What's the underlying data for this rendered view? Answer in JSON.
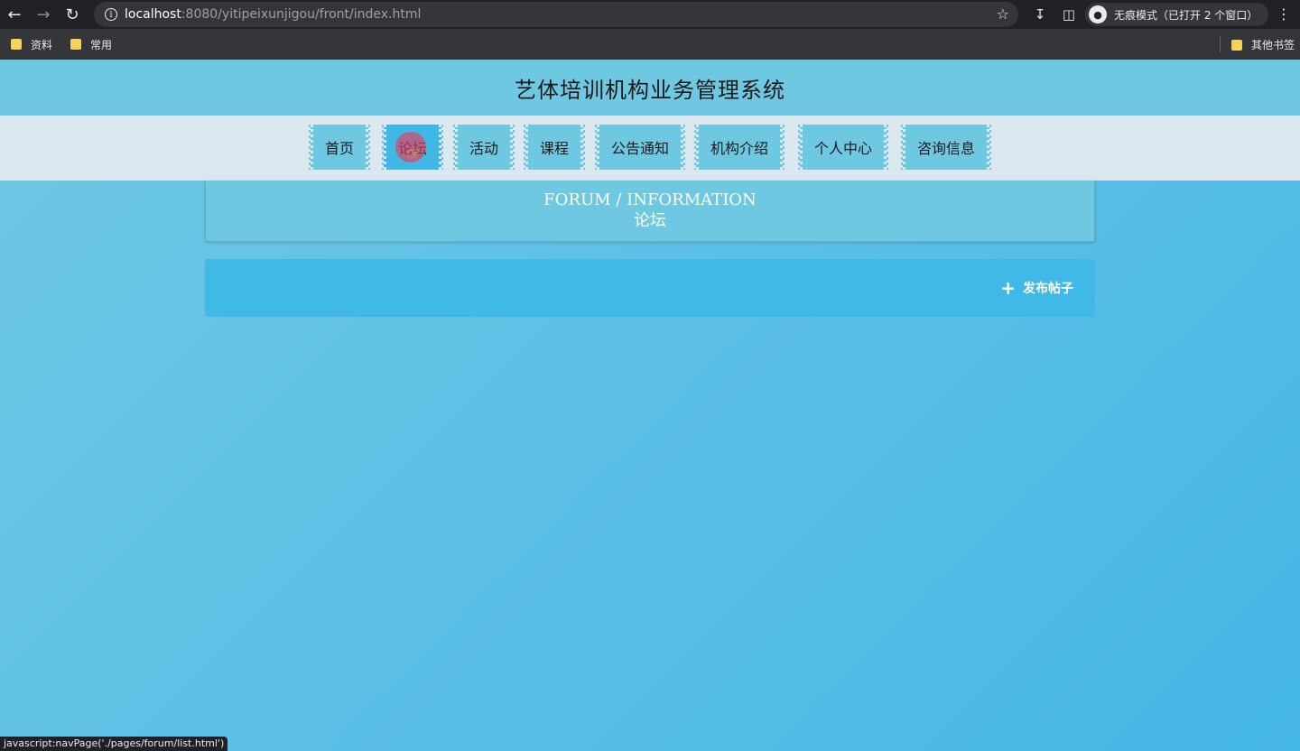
{
  "browser": {
    "back_icon": "arrow-left-icon",
    "forward_icon": "arrow-right-icon",
    "reload_icon": "reload-icon",
    "url_host": "localhost",
    "url_path": ":8080/yitipeixunjigou/front/index.html",
    "incognito_label": "无痕模式（已打开 2 个窗口）"
  },
  "bookmarks": {
    "items": [
      "资料",
      "常用"
    ],
    "other": "其他书签"
  },
  "site": {
    "title": "艺体培训机构业务管理系统"
  },
  "menu": {
    "items": [
      "首页",
      "论坛",
      "活动",
      "课程",
      "公告通知",
      "机构介绍",
      "个人中心",
      "咨询信息"
    ],
    "active": "论坛"
  },
  "banner": {
    "en": "FORUM / INFORMATION",
    "zh": "论坛"
  },
  "actions": {
    "post_label": "发布帖子"
  },
  "status": {
    "text": "javascript:navPage('./pages/forum/list.html')"
  },
  "colors": {
    "header": "#6fc8e2",
    "menu_bg": "#dce8f0",
    "active": "#41b7e6"
  }
}
